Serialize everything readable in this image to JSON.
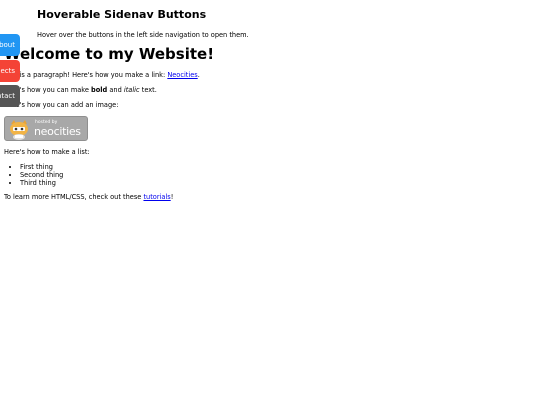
{
  "header": {
    "title": "Hoverable Sidenav Buttons",
    "description": "Hover over the buttons in the left side navigation to open them."
  },
  "sidenav": {
    "items": [
      {
        "label": "About",
        "color": "#2196F3"
      },
      {
        "label": "Projects",
        "color": "#f44336"
      },
      {
        "label": "Contact",
        "color": "#555555"
      }
    ]
  },
  "main": {
    "heading": "Welcome to my Website!",
    "para1_prefix": "This is a paragraph! Here's how you make a link: ",
    "para1_link": "Neocities",
    "para1_suffix": ".",
    "para2_prefix": "Here's how you can make ",
    "para2_bold": "bold",
    "para2_mid": " and ",
    "para2_italic": "italic",
    "para2_suffix": " text.",
    "para3": "Here's how you can add an image:",
    "badge": {
      "hosted_by": "hosted by",
      "name": "neocities"
    },
    "para4": "Here's how to make a list:",
    "list_items": [
      "First thing",
      "Second thing",
      "Third thing"
    ],
    "para5_prefix": "To learn more HTML/CSS, check out these ",
    "para5_link": "tutorials",
    "para5_suffix": "!"
  }
}
